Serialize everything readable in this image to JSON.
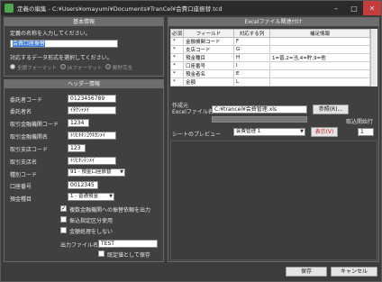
{
  "window": {
    "title": "定義の編集 - C:¥Users¥omayumi¥Documents¥TranCel¥会費口座振替.tcd"
  },
  "basic": {
    "section_title": "基本情報",
    "name_prompt": "定義の名称を入力してください。",
    "name_value": "会費口座振替",
    "format_prompt": "対応するデータ形式を選択してください。",
    "formats": [
      "全銀フォーマット",
      "JAフォーマット",
      "郵貯完全"
    ]
  },
  "header": {
    "section_title": "ヘッダー情報",
    "fields": [
      {
        "label": "委託者コード",
        "value": "0123456789"
      },
      {
        "label": "委託者名",
        "value": "ｲﾀｸｼｬﾒｲ"
      },
      {
        "label": "取引金融機関コード",
        "value": "1234"
      },
      {
        "label": "取引金融機関名",
        "value": "ﾄﾘﾋｷｷﾝﾕｳｷｶﾝﾒｲ"
      },
      {
        "label": "取引支店コード",
        "value": "123"
      },
      {
        "label": "取引支店名",
        "value": "ﾄﾘﾋｷｼﾃﾝﾒｲ"
      }
    ],
    "type_code_label": "種別コード",
    "type_code_value": "91 - 預金口座振替",
    "account_label": "口座番号",
    "account_value": "0012345",
    "deposit_label": "預金種目",
    "deposit_value": "1 - 普通預金",
    "checks": [
      {
        "label": "複数金融機関への振替依頼を出力",
        "checked": true
      },
      {
        "label": "振込指定区分使用",
        "checked": false
      },
      {
        "label": "金額処理をしない",
        "checked": false
      }
    ],
    "output_label": "出力ファイル名",
    "output_value": "TEST",
    "overwrite_label": "既定値として保存",
    "overwrite_checked": false
  },
  "excel": {
    "section_title": "Excelファイル関連付け",
    "columns": [
      "必須",
      "フィールド",
      "対応する列",
      "補足情報"
    ],
    "rows": [
      {
        "req": "*",
        "field": "金融機関コード",
        "col": "F",
        "note": ""
      },
      {
        "req": "*",
        "field": "支店コード",
        "col": "G",
        "note": ""
      },
      {
        "req": "*",
        "field": "預金種目",
        "col": "H",
        "note": "1=普,2=当,4=貯,9=他"
      },
      {
        "req": "*",
        "field": "口座番号",
        "col": "I",
        "note": ""
      },
      {
        "req": "*",
        "field": "預金者名",
        "col": "E",
        "note": ""
      },
      {
        "req": "*",
        "field": "金額",
        "col": "L",
        "note": ""
      }
    ],
    "file_label": "作成元\nExcelファイル名",
    "file_value": "C:¥trancel¥会費管理.xls",
    "browse_label": "参照(R)...",
    "preview_label": "シートのプレビュー",
    "sheet_value": "会費管理 1",
    "show_label": "表示(V)",
    "start_row_label": "取込開始行",
    "start_row_value": "1"
  },
  "footer": {
    "save_label": "保存",
    "cancel_label": "キャンセル"
  }
}
